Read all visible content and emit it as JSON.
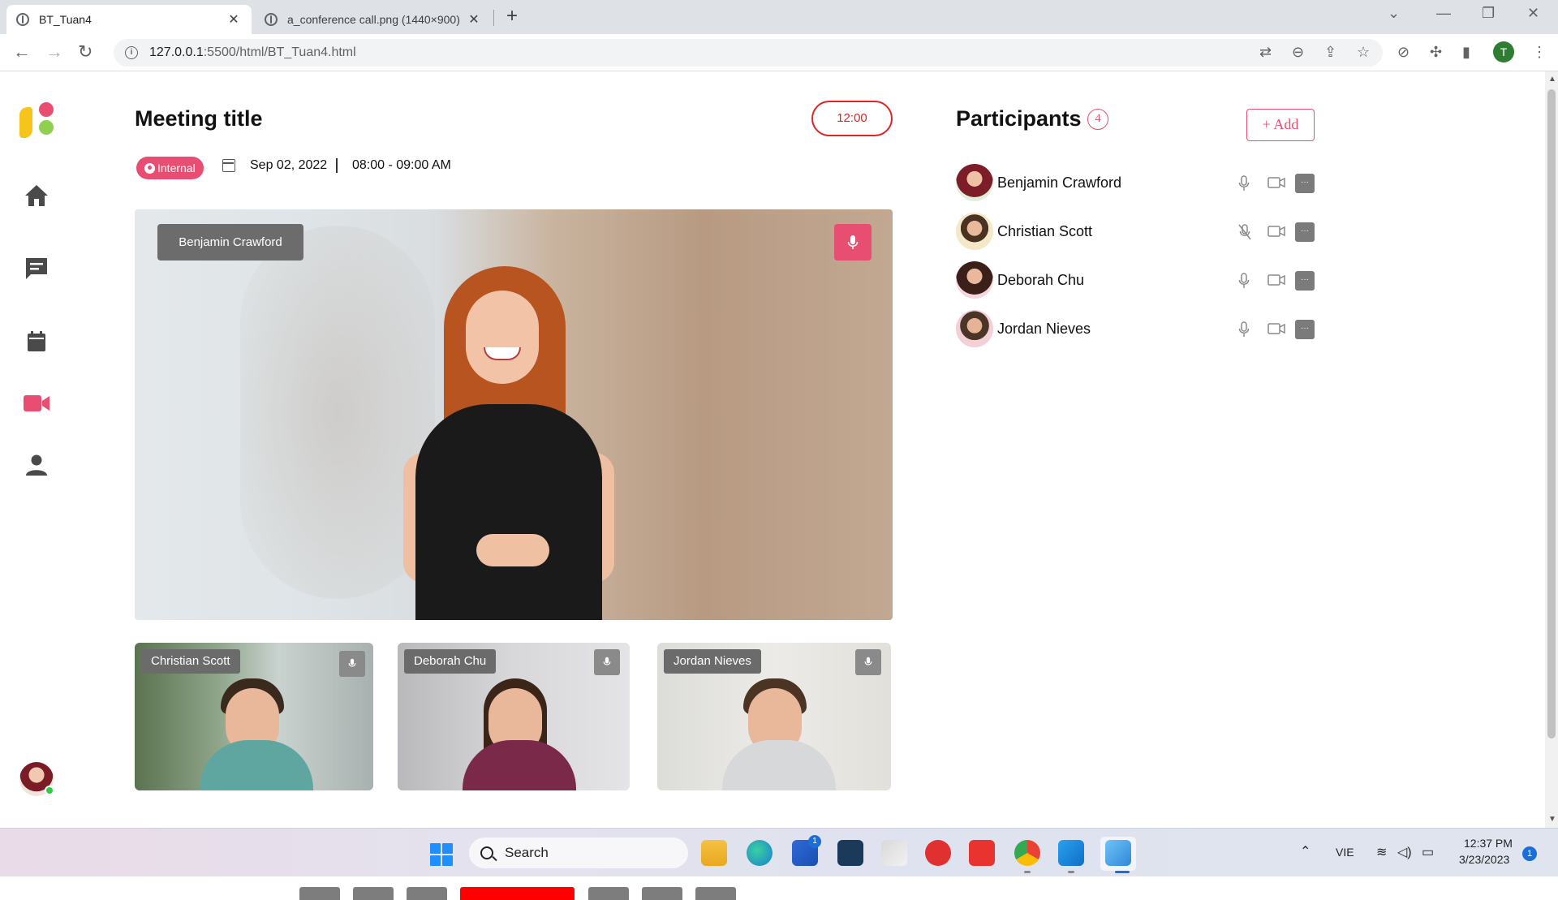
{
  "browser": {
    "tabs": [
      {
        "title": "BT_Tuan4",
        "active": true
      },
      {
        "title": "a_conference call.png (1440×900)",
        "active": false
      }
    ],
    "new_tab": "+",
    "close_glyph": "✕",
    "url_host": "127.0.0.1",
    "url_rest": ":5500/html/BT_Tuan4.html",
    "profile_initial": "T"
  },
  "sidebar": {
    "nav": [
      {
        "icon": "home-icon",
        "active": false
      },
      {
        "icon": "chat-icon",
        "active": false
      },
      {
        "icon": "calendar-icon",
        "active": false
      },
      {
        "icon": "video-camera-icon",
        "active": true
      },
      {
        "icon": "user-icon",
        "active": false
      }
    ],
    "accent": "#e84e72",
    "icon_color": "#4a4a4a"
  },
  "meeting": {
    "title": "Meeting title",
    "timer": "12:00",
    "badge": "Internal",
    "date": "Sep 02, 2022",
    "time": "08:00 - 09:00 AM",
    "main_speaker": "Benjamin Crawford",
    "thumbnails": [
      {
        "name": "Christian Scott"
      },
      {
        "name": "Deborah Chu"
      },
      {
        "name": "Jordan Nieves"
      }
    ]
  },
  "participants": {
    "title": "Participants",
    "count": "4",
    "add_label": "+ Add",
    "more_label": "···",
    "list": [
      {
        "name": "Benjamin Crawford",
        "mic_muted": false
      },
      {
        "name": "Christian Scott",
        "mic_muted": true
      },
      {
        "name": "Deborah Chu",
        "mic_muted": false
      },
      {
        "name": "Jordan Nieves",
        "mic_muted": false
      }
    ]
  },
  "taskbar": {
    "search_label": "Search",
    "store_badge": "1",
    "language": "VIE",
    "time": "12:37 PM",
    "date": "3/23/2023",
    "notifications": "1"
  },
  "colors": {
    "accent": "#e84e72",
    "timer_red": "#e02424",
    "control_red": "#ff0000"
  }
}
